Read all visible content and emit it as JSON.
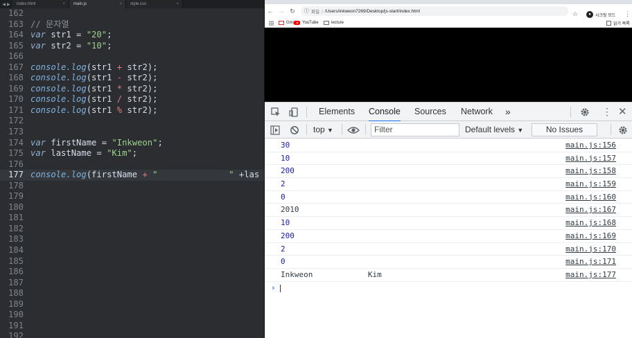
{
  "editor": {
    "tabs": [
      {
        "label": "index.html"
      },
      {
        "label": "main.js"
      },
      {
        "label": "style.css"
      }
    ],
    "lines": [
      {
        "num": "162",
        "text": ""
      },
      {
        "num": "163",
        "text": "// 문자열"
      },
      {
        "num": "164",
        "text": "var str1 = \"20\";"
      },
      {
        "num": "165",
        "text": "var str2 = \"10\";"
      },
      {
        "num": "166",
        "text": ""
      },
      {
        "num": "167",
        "text": "console.log(str1 + str2);"
      },
      {
        "num": "168",
        "text": "console.log(str1 - str2);"
      },
      {
        "num": "169",
        "text": "console.log(str1 * str2);"
      },
      {
        "num": "170",
        "text": "console.log(str1 / str2);"
      },
      {
        "num": "171",
        "text": "console.log(str1 % str2);"
      },
      {
        "num": "172",
        "text": ""
      },
      {
        "num": "173",
        "text": ""
      },
      {
        "num": "174",
        "text": "var firstName = \"Inkweon\";"
      },
      {
        "num": "175",
        "text": "var lastName = \"Kim\";"
      },
      {
        "num": "176",
        "text": ""
      },
      {
        "num": "177",
        "text": "console.log(firstName + \"              \" +las"
      },
      {
        "num": "178",
        "text": ""
      },
      {
        "num": "179",
        "text": ""
      },
      {
        "num": "180",
        "text": ""
      },
      {
        "num": "181",
        "text": ""
      },
      {
        "num": "182",
        "text": ""
      },
      {
        "num": "183",
        "text": ""
      },
      {
        "num": "184",
        "text": ""
      },
      {
        "num": "185",
        "text": ""
      },
      {
        "num": "186",
        "text": ""
      },
      {
        "num": "187",
        "text": ""
      },
      {
        "num": "188",
        "text": ""
      },
      {
        "num": "189",
        "text": ""
      },
      {
        "num": "190",
        "text": ""
      },
      {
        "num": "191",
        "text": ""
      },
      {
        "num": "192",
        "text": ""
      }
    ],
    "current_line": "177"
  },
  "browser": {
    "address": {
      "info": "ⓘ",
      "scheme_label": "파일",
      "url": "/Users/inkweon7269/Desktop/js-start/index.html"
    },
    "profile_label": "시크릿 모드",
    "bookmarks": {
      "gmail": "Gmail",
      "youtube": "YouTube",
      "lecture": "lecture",
      "reading_list": "읽기 목록"
    }
  },
  "devtools": {
    "tabs": [
      "Elements",
      "Console",
      "Sources",
      "Network"
    ],
    "more": "»",
    "context": "top",
    "filter_placeholder": "Filter",
    "levels": "Default levels",
    "no_issues": "No Issues",
    "messages": [
      {
        "value": "30",
        "source": "main.js:156",
        "kind": "num"
      },
      {
        "value": "10",
        "source": "main.js:157",
        "kind": "num"
      },
      {
        "value": "200",
        "source": "main.js:158",
        "kind": "num"
      },
      {
        "value": "2",
        "source": "main.js:159",
        "kind": "num"
      },
      {
        "value": "0",
        "source": "main.js:160",
        "kind": "num"
      },
      {
        "value": "2010",
        "source": "main.js:167",
        "kind": "str"
      },
      {
        "value": "10",
        "source": "main.js:168",
        "kind": "num"
      },
      {
        "value": "200",
        "source": "main.js:169",
        "kind": "num"
      },
      {
        "value": "2",
        "source": "main.js:170",
        "kind": "num"
      },
      {
        "value": "0",
        "source": "main.js:171",
        "kind": "num"
      },
      {
        "value": "Inkweon            Kim",
        "source": "main.js:177",
        "kind": "str"
      }
    ]
  },
  "colors": {
    "accent": "#1a73e8",
    "console_number": "#1a1aa6",
    "editor_bg": "#2b2d30"
  }
}
